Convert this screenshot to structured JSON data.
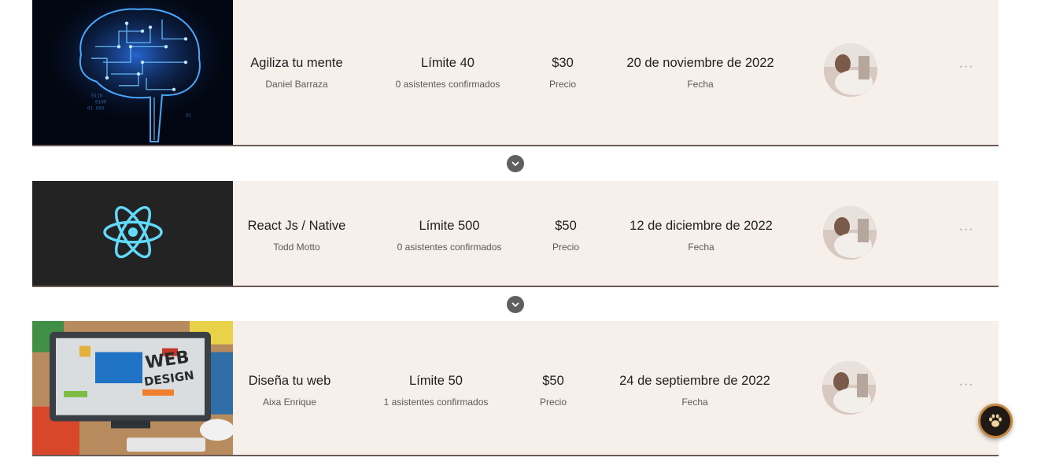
{
  "events": [
    {
      "title": "Agiliza tu mente",
      "author": "Daniel Barraza",
      "limit": "Límite 40",
      "attendees": "0 asistentes confirmados",
      "price": "$30",
      "price_label": "Precio",
      "date": "20 de noviembre de 2022",
      "date_label": "Fecha",
      "more": "···"
    },
    {
      "title": "React Js / Native",
      "author": "Todd Motto",
      "limit": "Límite 500",
      "attendees": "0 asistentes confirmados",
      "price": "$50",
      "price_label": "Precio",
      "date": "12 de diciembre de 2022",
      "date_label": "Fecha",
      "more": "···"
    },
    {
      "title": "Diseña tu web",
      "author": "Aixa Enrique",
      "limit": "Límite 50",
      "attendees": "1 asistentes confirmados",
      "price": "$50",
      "price_label": "Precio",
      "date": "24 de septiembre de 2022",
      "date_label": "Fecha",
      "more": "···"
    }
  ],
  "icons": {
    "expand": "chevron-down-icon",
    "more": "more-dots-icon",
    "fab": "paw-icon"
  },
  "colors": {
    "card_bg": "#f6efea",
    "card_border": "#6b5a55",
    "chevron_bg": "#5f5f5f",
    "react_cyan": "#61dafb",
    "fab_ring": "#c7863b"
  }
}
